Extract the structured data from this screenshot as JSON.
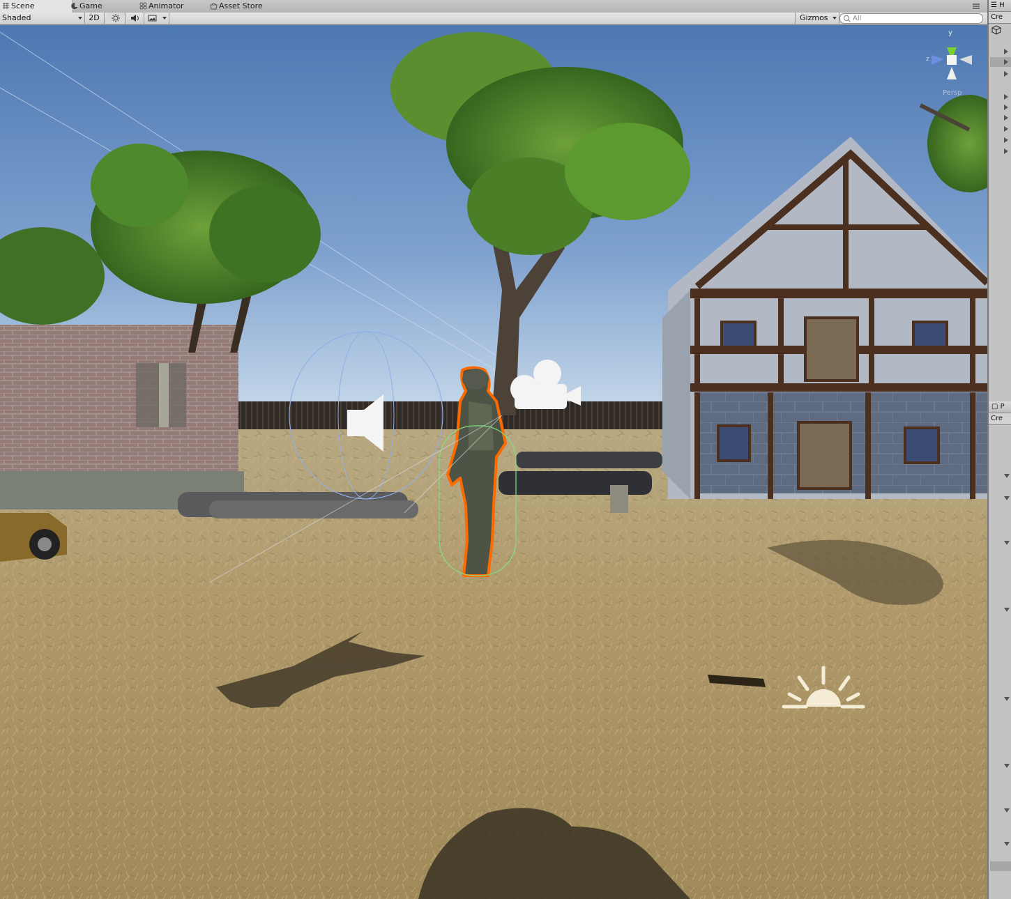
{
  "tabs": [
    {
      "label": "Scene",
      "icon": "scene-icon"
    },
    {
      "label": "Game",
      "icon": "game-icon"
    },
    {
      "label": "Animator",
      "icon": "animator-icon"
    },
    {
      "label": "Asset Store",
      "icon": "asset-store-icon"
    }
  ],
  "toolbar": {
    "draw_mode": "Shaded",
    "mode_2d": "2D",
    "lighting_icon": "sun-icon",
    "audio_icon": "speaker-icon",
    "effects_icon": "image-icon",
    "gizmos_label": "Gizmos",
    "search_placeholder": "All"
  },
  "scene": {
    "orientation": {
      "y_label": "y",
      "z_label": "z",
      "persp_label": "Persp"
    },
    "gizmo_icons": [
      "audio-source-icon",
      "camera-icon",
      "directional-light-icon"
    ],
    "selected_object": "soldier-character",
    "colors": {
      "sky_top": "#4f79b4",
      "sky_horizon": "#cfe0ee",
      "ground": "#b29e72",
      "selection_outline": "#ff6a00",
      "collider": "#7fe07f"
    }
  },
  "right_panel": {
    "top_header": "H",
    "top_create": "Cre",
    "mid_header": "P",
    "mid_create": "Cre"
  }
}
